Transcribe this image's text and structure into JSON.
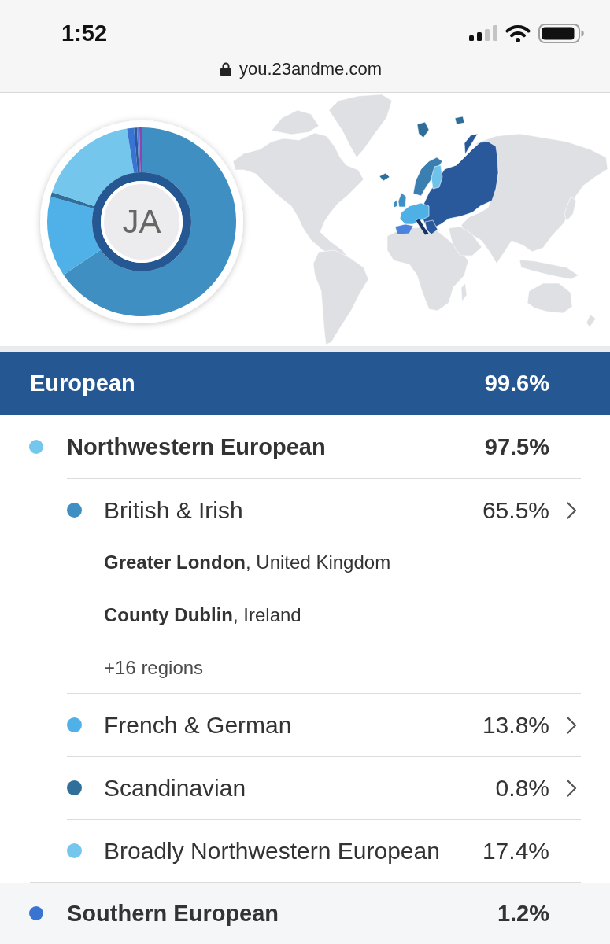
{
  "status_bar": {
    "time": "1:52"
  },
  "address_bar": {
    "url": "you.23andme.com",
    "secure": true
  },
  "summary": {
    "initials": "JA"
  },
  "group": {
    "name": "European",
    "percent": "99.6%"
  },
  "regions": [
    {
      "name": "Northwestern European",
      "percent": "97.5%",
      "color": "#74c7ec",
      "highlighted": false,
      "children": [
        {
          "name": "British & Irish",
          "percent": "65.5%",
          "color": "#3f8fc2",
          "has_details": true,
          "locations": [
            "**Greater London**, United Kingdom",
            "**County Dublin**, Ireland"
          ],
          "more_regions": "+16 regions"
        },
        {
          "name": "French & German",
          "percent": "13.8%",
          "color": "#4fb1e7",
          "has_details": true
        },
        {
          "name": "Scandinavian",
          "percent": "0.8%",
          "color": "#2f6f99",
          "has_details": true
        },
        {
          "name": "Broadly Northwestern European",
          "percent": "17.4%",
          "color": "#74c6ec",
          "has_details": false
        }
      ]
    },
    {
      "name": "Southern European",
      "percent": "1.2%",
      "color": "#3a74d2",
      "highlighted": true
    }
  ]
}
